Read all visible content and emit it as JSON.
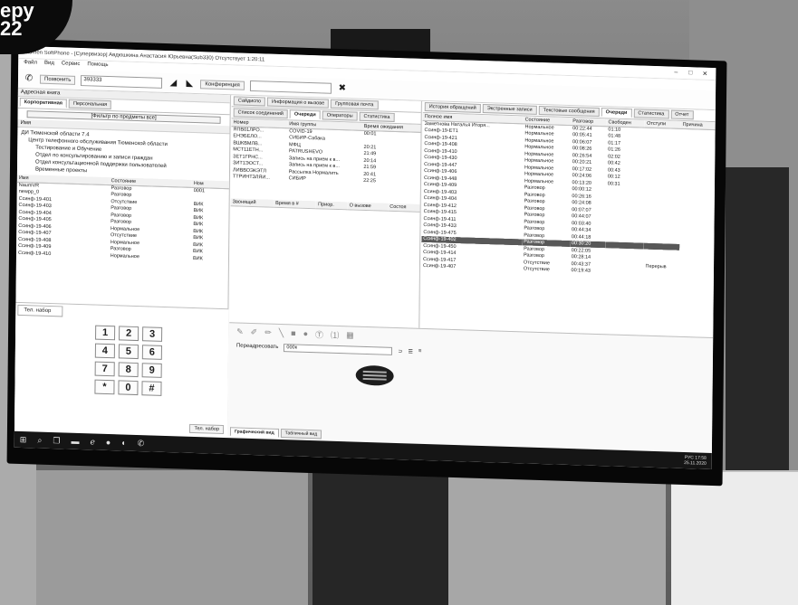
{
  "badge": {
    "line1": "еру",
    "line2": "22"
  },
  "window": {
    "title": "Naumen SoftPhone - [Супервизор] Авдюшкина Анастасия Юрьевна(Sub330) Отсутствует 1:20:11"
  },
  "menu": [
    "Файл",
    "Вид",
    "Сервис",
    "Помощь"
  ],
  "toolbar": {
    "call_label": "Позвонить",
    "call_value": "393333",
    "conference_label": "Конференция"
  },
  "address_book": {
    "title": "Адресная книга",
    "tabs": [
      "Корпоративная",
      "Персональная"
    ],
    "filter_label": "[Фильтр по предметы все]",
    "tree_header": "Имя",
    "tree": [
      "ДИ Тюменской области 7.4",
      "Центр телефонного обслуживания Тюменской области",
      "Тестирование и Обучение",
      "Отдел по консультированию и записи граждан",
      "Отдел консультационной поддержки пользователей",
      "Временные проекты"
    ],
    "columns": [
      "Имя",
      "Состояние",
      "Ном"
    ],
    "rows": [
      [
        "NaumVR",
        "Разговор",
        "0001"
      ],
      [
        "newpp_0",
        "Разговор",
        ""
      ],
      [
        "Ссинф-19-401",
        "Отсутствие",
        "ВИК"
      ],
      [
        "Ссинф-19-403",
        "Разговор",
        "ВИК"
      ],
      [
        "Ссинф-19-404",
        "Разговор",
        "ВИК"
      ],
      [
        "Ссинф-19-405",
        "Разговор",
        "ВИК"
      ],
      [
        "Ссинф-19-406",
        "Нормальное",
        "ВИК"
      ],
      [
        "Ссинф-19-407",
        "Отсутствие",
        "ВИК"
      ],
      [
        "Ссинф-19-408",
        "Нормальное",
        "ВИК"
      ],
      [
        "Ссинф-19-409",
        "Разговор",
        "ВИК"
      ],
      [
        "Ссинф-19-410",
        "Нормальное",
        "ВИК"
      ]
    ]
  },
  "dialer": {
    "tab": "Тел. набор",
    "keys": [
      "1",
      "2",
      "3",
      "4",
      "5",
      "6",
      "7",
      "8",
      "9",
      "*",
      "0",
      "#"
    ],
    "button": "Тел. набор"
  },
  "top_tabs": [
    "Сайдиспо",
    "Информация о вызове",
    "Групповая почта",
    "История обращений",
    "Экстренные записи",
    "Текстовые сообщения",
    "Очереди",
    "Статистика",
    "Отчет"
  ],
  "queues": {
    "subtabs": [
      "Список соединений",
      "Очереди",
      "Операторы",
      "Статистика"
    ],
    "columns": [
      "Номер",
      "Имя группы",
      "Время ожидания"
    ],
    "rows": [
      [
        "ЯПВ01ЛРО...",
        "COVID-19",
        "00:01"
      ],
      [
        "ЕНЭБЕЛО...",
        "СИБИР-Сабака",
        ""
      ],
      [
        "ВШКВМЛВ...",
        "МФЦ",
        "20:21"
      ],
      [
        "МСТ11ЕТН...",
        "PATRUSHEVO",
        "21:49"
      ],
      [
        "ЗЕТ1ГРНС...",
        "Запись на прием к в...",
        "20:14"
      ],
      [
        "ЗИТ1ЭОСТ...",
        "Запись на прием к в...",
        "21:59"
      ],
      [
        "ЛИВВОЭКЭТЛ",
        "Рассылка Нормалить",
        "20:41"
      ],
      [
        "ТТРИНТЗЛЯЙ...",
        "СИБИР",
        "22:25"
      ]
    ],
    "lower_columns": [
      "Звонящий",
      "Время в #",
      "Приор.",
      "О вызове",
      "Состоя"
    ]
  },
  "operators": {
    "columns": [
      "Полное имя",
      "Состояние",
      "Разговор",
      "Свободен",
      "Отступи",
      "Причина"
    ],
    "rows": [
      [
        "Заметнова Наталья Иторя...",
        "Нормальное",
        "00:22:44",
        "01:10",
        ""
      ],
      [
        "Ссинф-19-ЕТ1",
        "Нормальное",
        "00:05:41",
        "01:48",
        ""
      ],
      [
        "Ссинф-19-421",
        "Нормальное",
        "00:06:07",
        "01:17",
        ""
      ],
      [
        "Ссинф-19-408",
        "Нормальное",
        "00:08:26",
        "01:26",
        ""
      ],
      [
        "Ссинф-19-410",
        "Нормальное",
        "00:26:54",
        "02:02",
        ""
      ],
      [
        "Ссинф-19-430",
        "Нормальное",
        "00:20:21",
        "00:42",
        ""
      ],
      [
        "Ссинф-19-447",
        "Нормальное",
        "00:17:02",
        "00:43",
        ""
      ],
      [
        "Ссинф-19-406",
        "Нормальное",
        "00:24:06",
        "00:12",
        ""
      ],
      [
        "Ссинф-19-448",
        "Нормальное",
        "00:13:20",
        "00:31",
        ""
      ],
      [
        "Ссинф-19-409",
        "Разговор",
        "00:00:12",
        "",
        ""
      ],
      [
        "Ссинф-19-403",
        "Разговор",
        "00:26:16",
        "",
        ""
      ],
      [
        "Ссинф-19-404",
        "Разговор",
        "00:24:08",
        "",
        ""
      ],
      [
        "Ссинф-19-412",
        "Разговор",
        "00:07:07",
        "",
        ""
      ],
      [
        "Ссинф-19-415",
        "Разговор",
        "00:44:07",
        "",
        ""
      ],
      [
        "Ссинф-19-411",
        "Разговор",
        "00:03:40",
        "",
        ""
      ],
      [
        "Ссинф-19-433",
        "Разговор",
        "00:44:34",
        "",
        ""
      ],
      [
        "Ссинф-19-475",
        "Разговор",
        "00:44:18",
        "",
        ""
      ],
      [
        "Ссинф-19-402",
        "Разговор",
        "00:30:20",
        "",
        ""
      ],
      [
        "Ссинф-19-450",
        "Разговор",
        "00:22:05",
        "",
        ""
      ],
      [
        "Ссинф-19-414",
        "Разговор",
        "00:28:14",
        "",
        ""
      ],
      [
        "Ссинф-19-417",
        "Отсутствие",
        "00:43:37",
        "",
        "Перерыв"
      ],
      [
        "Ссинф-19-407",
        "Отсутствие",
        "00:19:43",
        "",
        ""
      ]
    ],
    "selected_index": 17
  },
  "bottom": {
    "forward_label": "Переадресовать",
    "forward_value": "000к",
    "tabs": [
      "Графический вид",
      "Табличный вид"
    ]
  },
  "taskbar": {
    "time": "17:58",
    "date": "25.11.2020",
    "lang": "РУС"
  }
}
